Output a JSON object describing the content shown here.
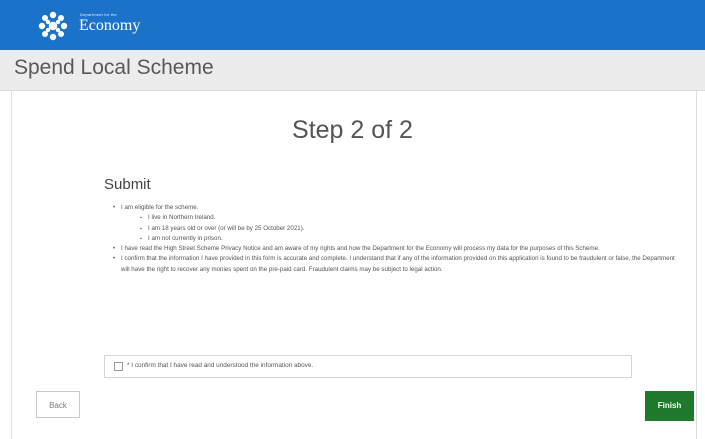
{
  "header": {
    "logo_small_text": "Department for the",
    "logo_name": "Economy"
  },
  "app": {
    "title": "Spend Local Scheme"
  },
  "step": {
    "title": "Step 2 of 2"
  },
  "form": {
    "heading": "Submit",
    "bullets": {
      "b1": "I am eligible for the scheme.",
      "b1_sub1": "I live in Northern Ireland.",
      "b1_sub2": "I am 18 years old or over (or will be by 25 October 2021).",
      "b1_sub3": "I am not currently in prison.",
      "b2": "I have read the High Street Scheme Privacy Notice and am aware of my rights and how the Department for the Economy will process my data for the purposes of this Scheme.",
      "b3": "I confirm that the information I have provided in this form is accurate and complete. I understand that if any of the information provided on this application is found to be fraudulent or false, the Department will have the right to recover any monies spent on the pre-paid card. Fraudulent claims may be subject to legal action."
    },
    "confirm_label": "* I confirm that I have read and understood the information above.",
    "confirm_checked": false
  },
  "actions": {
    "back_label": "Back",
    "finish_label": "Finish"
  },
  "colors": {
    "header_blue": "#1a73c9",
    "finish_green": "#1f7a2c"
  }
}
